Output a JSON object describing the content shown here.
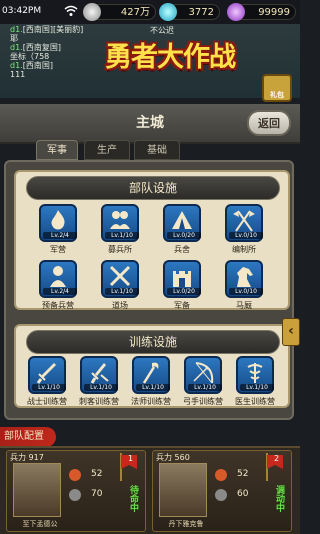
{
  "status_bar": {
    "time": "03:42PM",
    "silver": "427万",
    "gems": "3772",
    "energy": "99999"
  },
  "chat": {
    "lines": [
      {
        "prefix": "d1.",
        "text": "[西南国][美丽豹]"
      },
      {
        "prefix": "",
        "text": "耶"
      },
      {
        "prefix": "d1.",
        "text": "[西南复国]"
      },
      {
        "prefix": "",
        "text": "坐标（758"
      },
      {
        "prefix": "d1.",
        "text": "[西南国]"
      },
      {
        "prefix": "",
        "text": "111"
      }
    ],
    "partial_right": "不公迟"
  },
  "logo_text": "勇者大作战",
  "gift_label": "礼包",
  "city": {
    "title": "主城",
    "back_label": "返回"
  },
  "tabs": [
    {
      "label": "军事",
      "active": true
    },
    {
      "label": "生产",
      "active": false
    },
    {
      "label": "基础",
      "active": false
    }
  ],
  "troop_facilities": {
    "title": "部队设施",
    "buildings": [
      {
        "name": "军营",
        "level": "Lv.2/4",
        "icon": "fire-icon"
      },
      {
        "name": "募兵所",
        "level": "Lv.1/10",
        "icon": "people-icon"
      },
      {
        "name": "兵舍",
        "level": "Lv.0/20",
        "icon": "tent-icon"
      },
      {
        "name": "编制所",
        "level": "Lv.0/10",
        "icon": "crossed-flags-icon"
      },
      {
        "name": "预备兵营",
        "level": "Lv.2/4",
        "icon": "soldier-icon"
      },
      {
        "name": "道场",
        "level": "Lv.1/10",
        "icon": "crossed-swords-icon"
      },
      {
        "name": "军备",
        "level": "Lv.0/20",
        "icon": "castle-icon"
      },
      {
        "name": "马厩",
        "level": "Lv.0/10",
        "icon": "horse-icon"
      }
    ]
  },
  "training_facilities": {
    "title": "训练设施",
    "buildings": [
      {
        "name": "战士训练营",
        "level": "Lv.1/10",
        "icon": "sword-icon"
      },
      {
        "name": "刺客训练营",
        "level": "Lv.1/10",
        "icon": "dagger-icon"
      },
      {
        "name": "法师训练营",
        "level": "Lv.1/10",
        "icon": "staff-icon"
      },
      {
        "name": "弓手训练营",
        "level": "Lv.1/10",
        "icon": "bow-icon"
      },
      {
        "name": "医生训练营",
        "level": "Lv.1/10",
        "icon": "medic-icon"
      }
    ]
  },
  "troop_config": {
    "title": "部队配置",
    "cards": [
      {
        "troops": "兵力 917",
        "name": "至下孟德公",
        "stat_a": "52",
        "stat_b": "70",
        "flag": "1",
        "action": "待命中",
        "action_color": "#6ae04a"
      },
      {
        "troops": "兵力 560",
        "name": "丹下雅克鲁",
        "stat_a": "52",
        "stat_b": "60",
        "flag": "2",
        "action": "调动中",
        "action_color": "#6ae04a"
      }
    ]
  },
  "colors": {
    "accent_gold": "#ffe24a",
    "tile_blue": "#2c78c0",
    "banner_red": "#a82018",
    "active_green": "#6ae04a"
  }
}
